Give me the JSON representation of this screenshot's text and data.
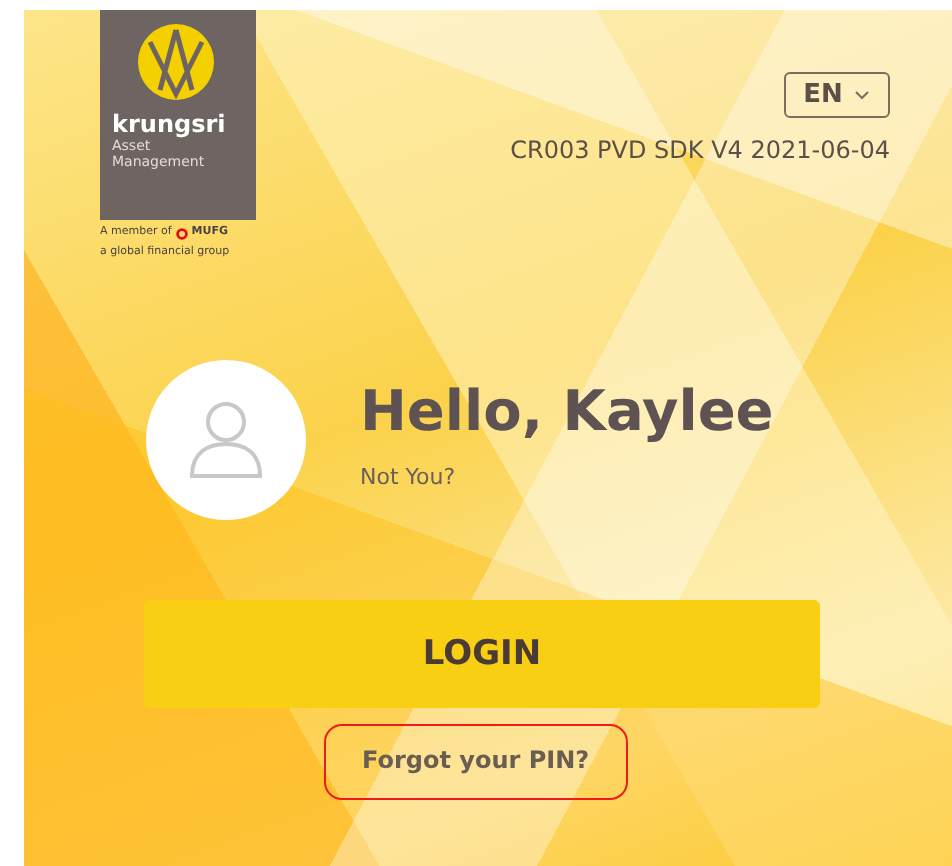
{
  "logo": {
    "name": "krungsri",
    "subtitle_lines": [
      "Asset",
      "Management"
    ]
  },
  "member_note": {
    "prefix": "A member of",
    "brand": "MUFG",
    "line2": "a global financial group"
  },
  "language": {
    "value": "EN"
  },
  "version": "CR003 PVD SDK V4 2021-06-04",
  "greeting": {
    "title": "Hello, Kaylee",
    "link": "Not You?"
  },
  "login_button": "LOGIN",
  "forgot_link": {
    "label": "Forgot your PIN?",
    "highlighted": true
  }
}
